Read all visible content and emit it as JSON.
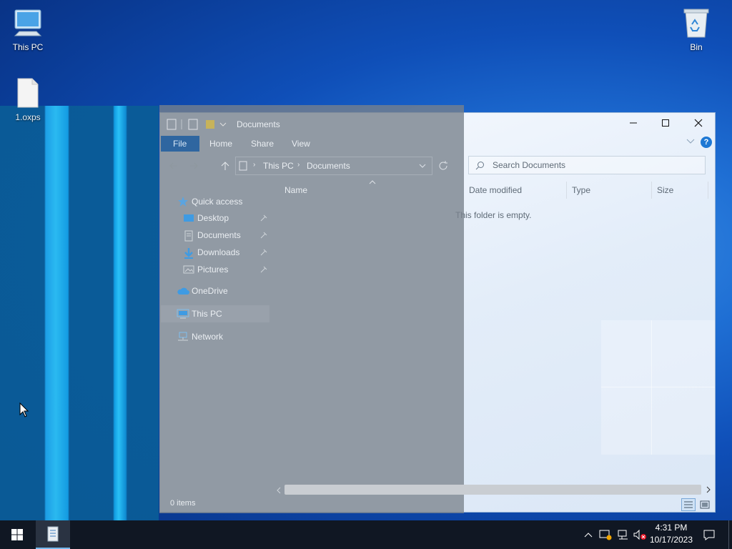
{
  "desktop": {
    "icons": [
      {
        "label": "This PC",
        "icon": "monitor-icon"
      },
      {
        "label": "1.oxps",
        "icon": "file-icon"
      },
      {
        "label": "Bin",
        "icon": "recycle-bin-icon"
      }
    ]
  },
  "explorer": {
    "title": "Documents",
    "ribbon_tabs": [
      "File",
      "Home",
      "Share",
      "View"
    ],
    "breadcrumb": [
      "This PC",
      "Documents"
    ],
    "search_placeholder": "Search Documents",
    "columns": [
      "Name",
      "Date modified",
      "Type",
      "Size"
    ],
    "empty_message": "This folder is empty.",
    "nav": [
      {
        "label": "Quick access",
        "icon": "star-icon"
      },
      {
        "label": "Desktop",
        "icon": "desktop-folder-icon",
        "pinned": true
      },
      {
        "label": "Documents",
        "icon": "documents-folder-icon",
        "pinned": true
      },
      {
        "label": "Downloads",
        "icon": "download-arrow-icon",
        "pinned": true
      },
      {
        "label": "Pictures",
        "icon": "pictures-folder-icon",
        "pinned": true
      },
      {
        "label": "OneDrive",
        "icon": "cloud-icon"
      },
      {
        "label": "This PC",
        "icon": "computer-icon",
        "selected": true
      },
      {
        "label": "Network",
        "icon": "network-icon"
      }
    ],
    "status": "0 items",
    "help_label": "?"
  },
  "taskbar": {
    "time": "4:31 PM",
    "date": "10/17/2023"
  },
  "colors": {
    "file_tab": "#1c74c4",
    "taskbar": "#101723",
    "accent": "#1e78d4"
  }
}
